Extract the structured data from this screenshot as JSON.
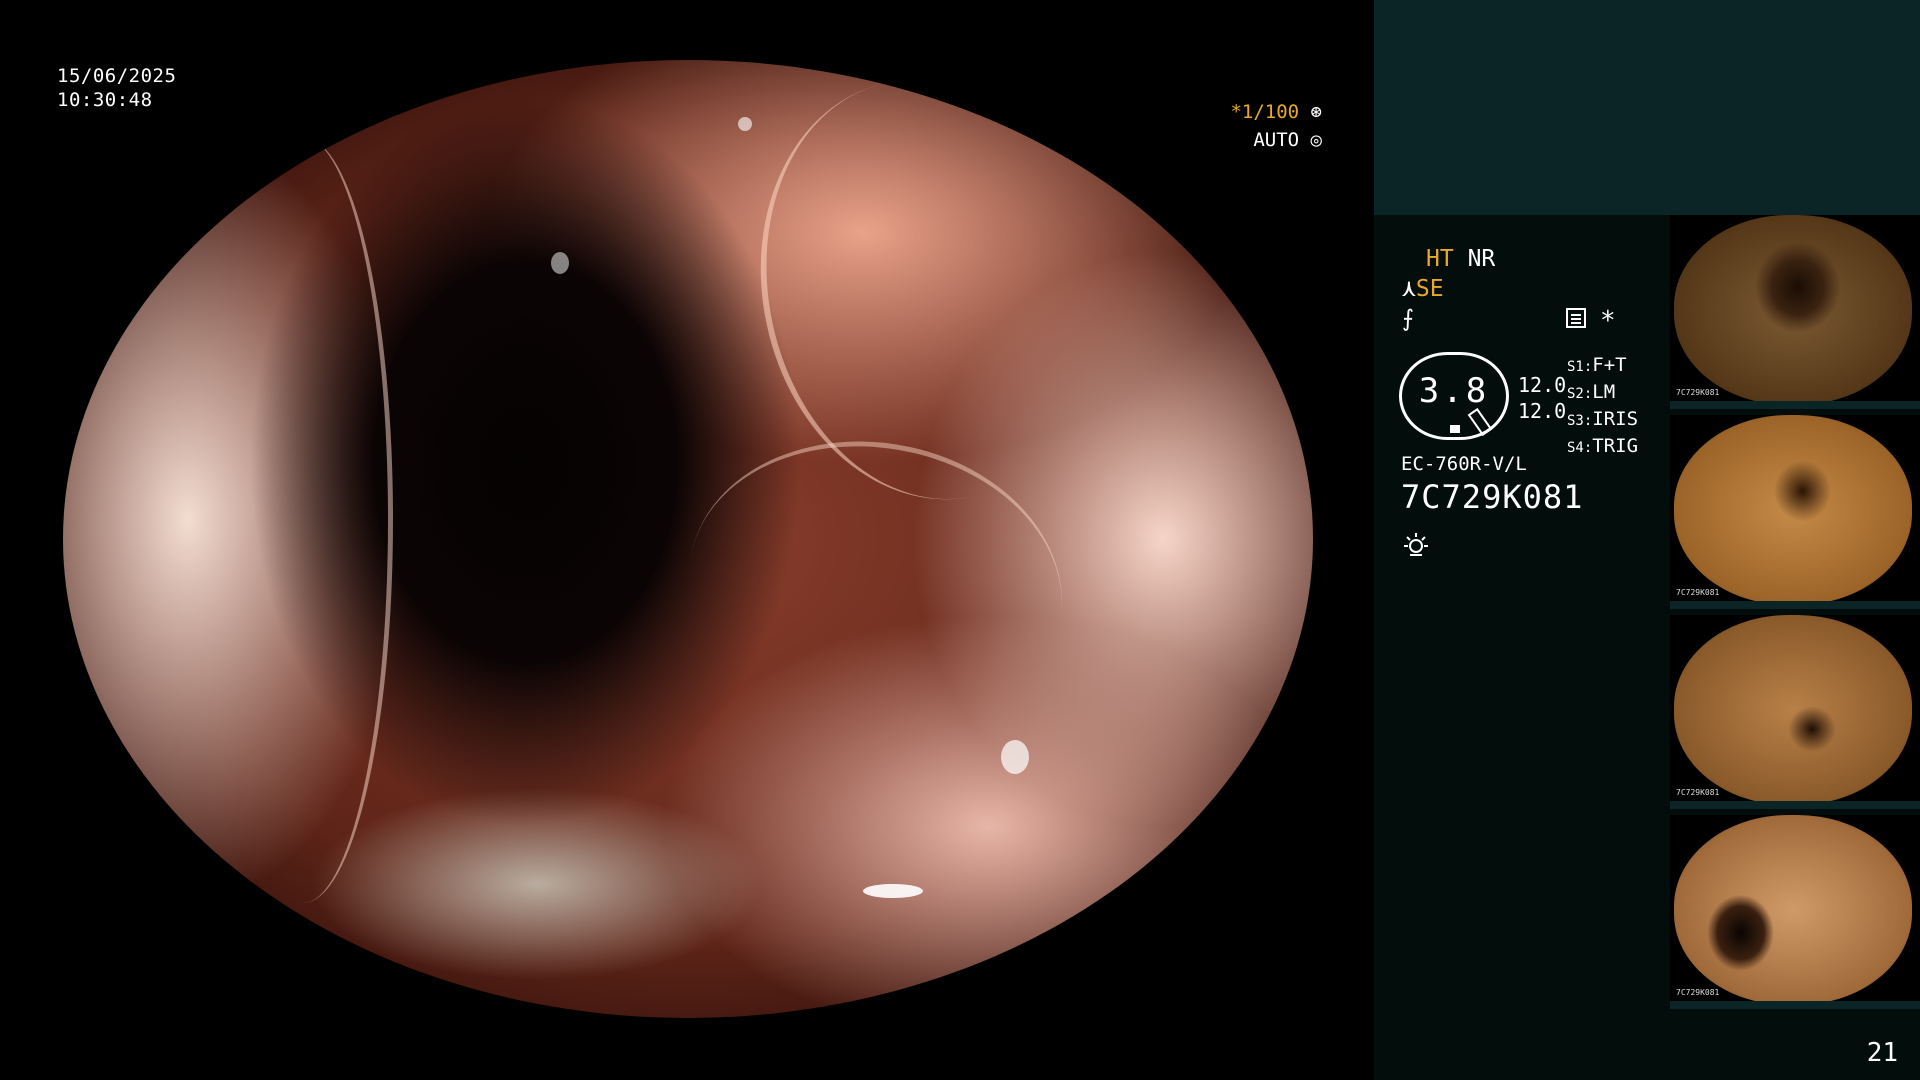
{
  "overlay": {
    "date": "15/06/2025",
    "time": "10:30:48",
    "shutter": "*1/100",
    "shutter_icon": "aperture-icon",
    "iris": "AUTO",
    "iris_icon": "iris-icon"
  },
  "panel": {
    "mode_ht": "HT",
    "mode_nr": "NR",
    "mode_se_prefix": "⋏",
    "mode_se": "SE",
    "enhance_icon": "enhance-icon",
    "asterisk": "*",
    "gauge_value": "3.8",
    "gauge_nums": [
      "12.0",
      "12.0"
    ],
    "switches": [
      {
        "key": "S1:",
        "value": "F+T"
      },
      {
        "key": "S2:",
        "value": "LM"
      },
      {
        "key": "S3:",
        "value": "IRIS"
      },
      {
        "key": "S4:",
        "value": "TRIG"
      }
    ],
    "scope_model": "EC-760R-V/L",
    "scope_serial": "7C729K081",
    "light_icon": "light-source-icon"
  },
  "thumbnails": [
    {
      "caption": "7C729K081"
    },
    {
      "caption": "7C729K081"
    },
    {
      "caption": "7C729K081"
    },
    {
      "caption": "7C729K081"
    }
  ],
  "page_number": "21",
  "colors": {
    "accent_orange": "#e8a928",
    "panel_top": "#0b2526",
    "panel_bg": "#030d0c"
  }
}
